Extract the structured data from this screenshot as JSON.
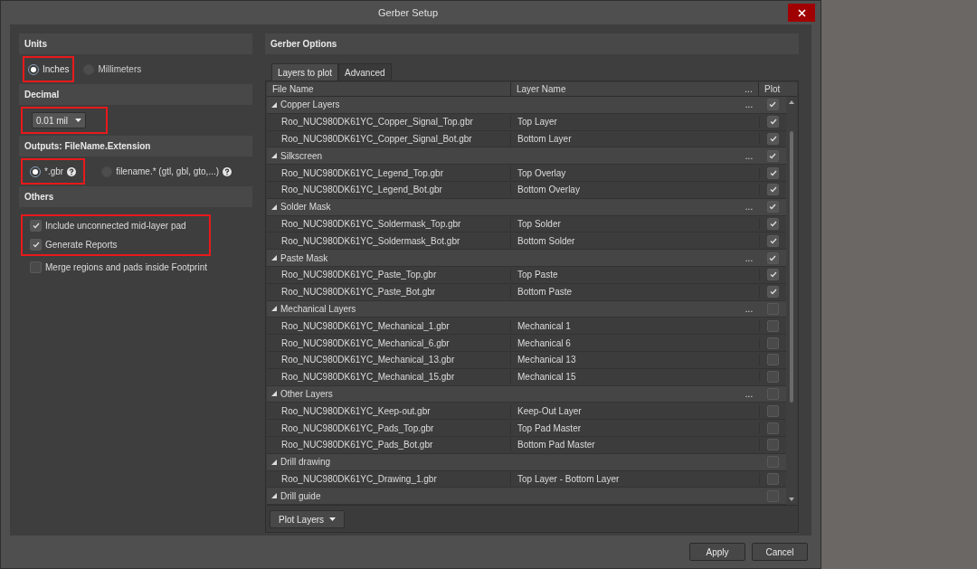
{
  "window": {
    "title": "Gerber Setup"
  },
  "units": {
    "heading": "Units",
    "options": [
      {
        "label": "Inches",
        "selected": true,
        "highlighted": true
      },
      {
        "label": "Millimeters",
        "selected": false,
        "highlighted": false
      }
    ]
  },
  "decimal": {
    "heading": "Decimal",
    "value": "0.01 mil",
    "highlighted": true
  },
  "outputs": {
    "heading": "Outputs: FileName.Extension",
    "options": [
      {
        "label": "*.gbr",
        "selected": true,
        "highlighted": true
      },
      {
        "label": "filename.* (gtl, gbl, gto,...)",
        "selected": false,
        "highlighted": false
      }
    ]
  },
  "others": {
    "heading": "Others",
    "checkboxes": [
      {
        "label": "Include unconnected mid-layer pad",
        "checked": true,
        "highlighted": true
      },
      {
        "label": "Generate Reports",
        "checked": true,
        "highlighted": true
      },
      {
        "label": "Merge regions and pads inside Footprint",
        "checked": false,
        "highlighted": false
      }
    ]
  },
  "gerber_options": {
    "heading": "Gerber Options",
    "tabs": [
      {
        "label": "Layers to plot",
        "selected": true
      },
      {
        "label": "Advanced",
        "selected": false
      }
    ],
    "table": {
      "columns": [
        "File Name",
        "Layer Name",
        "...",
        "Plot"
      ],
      "groups": [
        {
          "name": "Copper Layers",
          "more": "...",
          "expanded": true,
          "plot": true,
          "rows": [
            {
              "file": "Roo_NUC980DK61YC_Copper_Signal_Top.gbr",
              "layer": "Top Layer",
              "plot": true
            },
            {
              "file": "Roo_NUC980DK61YC_Copper_Signal_Bot.gbr",
              "layer": "Bottom Layer",
              "plot": true
            }
          ]
        },
        {
          "name": "Silkscreen",
          "more": "...",
          "expanded": true,
          "plot": true,
          "rows": [
            {
              "file": "Roo_NUC980DK61YC_Legend_Top.gbr",
              "layer": "Top Overlay",
              "plot": true
            },
            {
              "file": "Roo_NUC980DK61YC_Legend_Bot.gbr",
              "layer": "Bottom Overlay",
              "plot": true
            }
          ]
        },
        {
          "name": "Solder Mask",
          "more": "...",
          "expanded": true,
          "plot": true,
          "rows": [
            {
              "file": "Roo_NUC980DK61YC_Soldermask_Top.gbr",
              "layer": "Top Solder",
              "plot": true
            },
            {
              "file": "Roo_NUC980DK61YC_Soldermask_Bot.gbr",
              "layer": "Bottom Solder",
              "plot": true
            }
          ]
        },
        {
          "name": "Paste Mask",
          "more": "...",
          "expanded": true,
          "plot": true,
          "rows": [
            {
              "file": "Roo_NUC980DK61YC_Paste_Top.gbr",
              "layer": "Top Paste",
              "plot": true
            },
            {
              "file": "Roo_NUC980DK61YC_Paste_Bot.gbr",
              "layer": "Bottom Paste",
              "plot": true
            }
          ]
        },
        {
          "name": "Mechanical Layers",
          "more": "...",
          "expanded": true,
          "plot": false,
          "rows": [
            {
              "file": "Roo_NUC980DK61YC_Mechanical_1.gbr",
              "layer": "Mechanical 1",
              "plot": false
            },
            {
              "file": "Roo_NUC980DK61YC_Mechanical_6.gbr",
              "layer": "Mechanical 6",
              "plot": false
            },
            {
              "file": "Roo_NUC980DK61YC_Mechanical_13.gbr",
              "layer": "Mechanical 13",
              "plot": false
            },
            {
              "file": "Roo_NUC980DK61YC_Mechanical_15.gbr",
              "layer": "Mechanical 15",
              "plot": false
            }
          ]
        },
        {
          "name": "Other Layers",
          "more": "...",
          "expanded": true,
          "plot": false,
          "rows": [
            {
              "file": "Roo_NUC980DK61YC_Keep-out.gbr",
              "layer": "Keep-Out Layer",
              "plot": false
            },
            {
              "file": "Roo_NUC980DK61YC_Pads_Top.gbr",
              "layer": "Top Pad Master",
              "plot": false
            },
            {
              "file": "Roo_NUC980DK61YC_Pads_Bot.gbr",
              "layer": "Bottom Pad Master",
              "plot": false
            }
          ]
        },
        {
          "name": "Drill drawing",
          "expanded": true,
          "plot": false,
          "rows": [
            {
              "file": "Roo_NUC980DK61YC_Drawing_1.gbr",
              "layer": "Top Layer - Bottom Layer",
              "plot": false
            }
          ]
        },
        {
          "name": "Drill guide",
          "expanded": true,
          "plot": false
        }
      ]
    },
    "plot_layers_button": "Plot Layers"
  },
  "buttons": [
    "Apply",
    "Cancel"
  ]
}
